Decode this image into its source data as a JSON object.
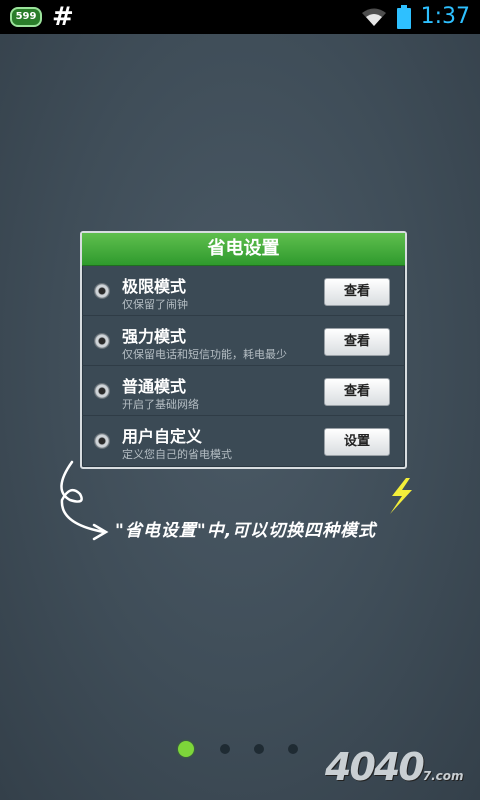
{
  "status_bar": {
    "notification_badge": "599",
    "hash_symbol": "#",
    "time": "1:37",
    "icons": [
      "wifi-icon",
      "battery-icon"
    ]
  },
  "panel": {
    "title": "省电设置",
    "modes": [
      {
        "title": "极限模式",
        "subtitle": "仅保留了闹钟",
        "button": "查看"
      },
      {
        "title": "强力模式",
        "subtitle": "仅保留电话和短信功能，耗电最少",
        "button": "查看"
      },
      {
        "title": "普通模式",
        "subtitle": "开启了基础网络",
        "button": "查看"
      },
      {
        "title": "用户自定义",
        "subtitle": "定义您自己的省电模式",
        "button": "设置"
      }
    ]
  },
  "annotation": {
    "text": "\"省电设置\"中,可以切换四种模式"
  },
  "pager": {
    "current": 1,
    "total": 4
  },
  "watermark": {
    "brand": "4040",
    "suffix": "7.com"
  },
  "colors": {
    "accent_green": "#3aa535",
    "time_blue": "#2ec0ff",
    "annot_yellow": "#f4ef3a"
  }
}
